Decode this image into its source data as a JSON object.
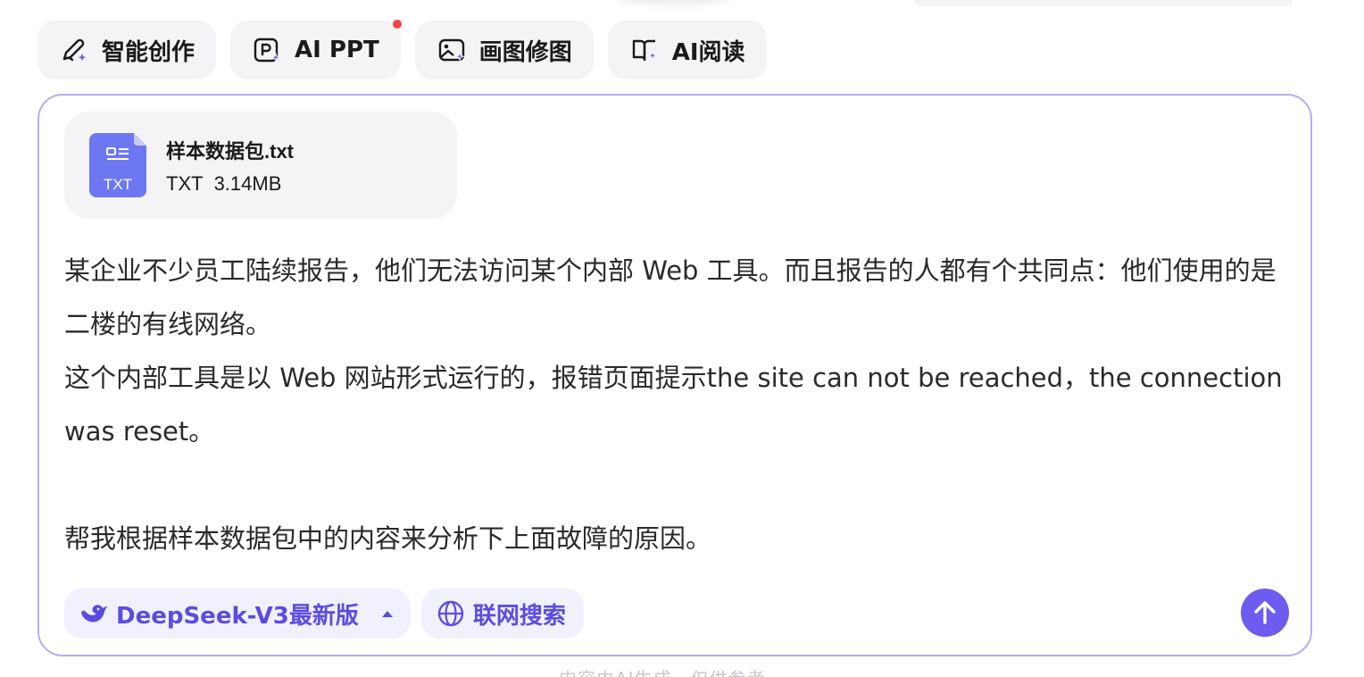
{
  "colors": {
    "accent": "#6c5cf0",
    "accent_text": "#5b4ce0",
    "composer_border": "#b3adf0",
    "chip_bg": "#f4f4f6",
    "file_icon": "#6d77f2",
    "badge_dot": "#ef4444"
  },
  "tools": [
    {
      "label": "智能创作",
      "icon": "pen-sparkle-icon"
    },
    {
      "label": "AI PPT",
      "icon": "ppt-sparkle-icon",
      "has_badge": true
    },
    {
      "label": "画图修图",
      "icon": "image-sparkle-icon"
    },
    {
      "label": "AI阅读",
      "icon": "book-sparkle-icon"
    }
  ],
  "attachment": {
    "name": "样本数据包.txt",
    "type": "TXT",
    "size": "3.14MB",
    "icon_label": "TXT",
    "icon": "txt-file-icon"
  },
  "prompt": {
    "text": "某企业不少员工陆续报告，他们无法访问某个内部 Web 工具。而且报告的人都有个共同点：他们使用的是二楼的有线网络。\n这个内部工具是以 Web 网站形式运行的，报错页面提示the site can not be reached，the connection was reset。\n\n帮我根据样本数据包中的内容来分析下上面故障的原因。"
  },
  "controls": {
    "model_label": "DeepSeek-V3最新版",
    "model_icon": "deepseek-whale-icon",
    "search_label": "联网搜索",
    "search_icon": "globe-icon",
    "send_icon": "arrow-up-icon"
  },
  "footer": {
    "disclaimer": "内容由AI生成，仅供参考"
  }
}
